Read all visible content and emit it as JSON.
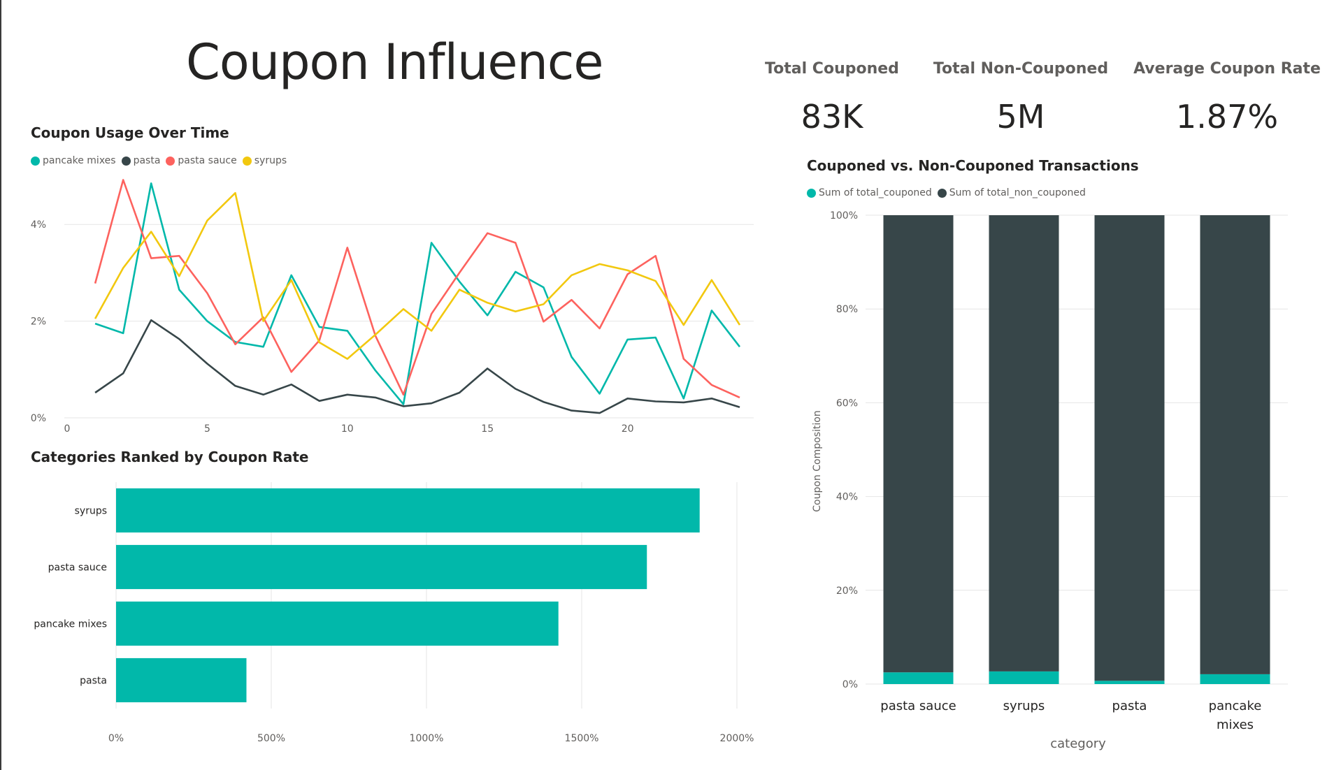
{
  "page": {
    "title": "Coupon Influence"
  },
  "kpis": [
    {
      "label": "Total Couponed",
      "value": "83K"
    },
    {
      "label": "Total Non-Couponed",
      "value": "5M"
    },
    {
      "label": "Average Coupon Rate",
      "value": "1.87%"
    }
  ],
  "colors": {
    "pancake_mixes": "#01b8aa",
    "pasta": "#374649",
    "pasta_sauce": "#fd625e",
    "syrups": "#f2c80f",
    "bar": "#01b8aa",
    "grid": "#e6e6e6",
    "axis_text": "#605e5c"
  },
  "chart_data": [
    {
      "type": "line",
      "title": "Coupon Usage Over Time",
      "xlabel": "",
      "ylabel": "",
      "xlim": [
        0,
        24.5
      ],
      "ylim": [
        0,
        5
      ],
      "x_ticks": [
        0,
        5,
        10,
        15,
        20
      ],
      "y_ticks": [
        0,
        2,
        4
      ],
      "y_tick_labels": [
        "0%",
        "2%",
        "4%"
      ],
      "legend_position": "top-left",
      "grid": true,
      "x": [
        1,
        2,
        3,
        4,
        5,
        6,
        7,
        8,
        9,
        10,
        11,
        12,
        13,
        14,
        15,
        16,
        17,
        18,
        19,
        20,
        21,
        22,
        23,
        24
      ],
      "series": [
        {
          "name": "pancake mixes",
          "color": "#01b8aa",
          "values": [
            1.95,
            1.75,
            4.85,
            2.65,
            2.0,
            1.57,
            1.47,
            2.95,
            1.88,
            1.8,
            0.98,
            0.28,
            3.62,
            2.82,
            2.12,
            3.02,
            2.7,
            1.26,
            0.5,
            1.62,
            1.66,
            0.4,
            2.22,
            1.47
          ]
        },
        {
          "name": "pasta",
          "color": "#374649",
          "values": [
            0.52,
            0.92,
            2.02,
            1.63,
            1.12,
            0.66,
            0.48,
            0.69,
            0.35,
            0.48,
            0.42,
            0.24,
            0.3,
            0.52,
            1.02,
            0.6,
            0.33,
            0.15,
            0.1,
            0.4,
            0.34,
            0.32,
            0.4,
            0.22
          ]
        },
        {
          "name": "pasta sauce",
          "color": "#fd625e",
          "values": [
            2.78,
            4.92,
            3.3,
            3.35,
            2.58,
            1.52,
            2.08,
            0.95,
            1.6,
            3.52,
            1.7,
            0.48,
            2.15,
            3.0,
            3.82,
            3.62,
            1.99,
            2.44,
            1.85,
            2.97,
            3.35,
            1.22,
            0.68,
            0.42
          ]
        },
        {
          "name": "syrups",
          "color": "#f2c80f",
          "values": [
            2.05,
            3.1,
            3.85,
            2.93,
            4.08,
            4.65,
            2.0,
            2.85,
            1.56,
            1.22,
            1.72,
            2.25,
            1.8,
            2.65,
            2.38,
            2.2,
            2.35,
            2.95,
            3.18,
            3.05,
            2.83,
            1.92,
            2.85,
            1.92
          ]
        }
      ]
    },
    {
      "type": "bar",
      "orientation": "horizontal",
      "title": "Categories Ranked by Coupon Rate",
      "xlabel": "",
      "ylabel": "",
      "categories": [
        "syrups",
        "pasta sauce",
        "pancake mixes",
        "pasta"
      ],
      "values": [
        1880,
        1710,
        1425,
        420
      ],
      "xlim": [
        0,
        2000
      ],
      "x_ticks": [
        0,
        500,
        1000,
        1500,
        2000
      ],
      "x_tick_labels": [
        "0%",
        "500%",
        "1000%",
        "1500%",
        "2000%"
      ],
      "grid": true
    },
    {
      "type": "bar",
      "stacked": "100%",
      "title": "Coupon­ed vs. Non-Couponed Transactions",
      "xlabel": "category",
      "ylabel": "Coupon Composition",
      "categories": [
        "pasta sauce",
        "syrups",
        "pasta",
        "pancake mixes"
      ],
      "category_lines": [
        [
          "pasta sauce"
        ],
        [
          "syrups"
        ],
        [
          "pasta"
        ],
        [
          "pancake",
          "mixes"
        ]
      ],
      "ylim": [
        0,
        100
      ],
      "y_ticks": [
        0,
        20,
        40,
        60,
        80,
        100
      ],
      "y_tick_labels": [
        "0%",
        "20%",
        "40%",
        "60%",
        "80%",
        "100%"
      ],
      "legend_position": "top-left",
      "grid": true,
      "series": [
        {
          "name": "Sum of total_couponed",
          "color": "#01b8aa",
          "values": [
            2.5,
            2.7,
            0.7,
            2.1
          ]
        },
        {
          "name": "Sum of total_non_couponed",
          "color": "#374649",
          "values": [
            97.5,
            97.3,
            99.3,
            97.9
          ]
        }
      ]
    }
  ]
}
